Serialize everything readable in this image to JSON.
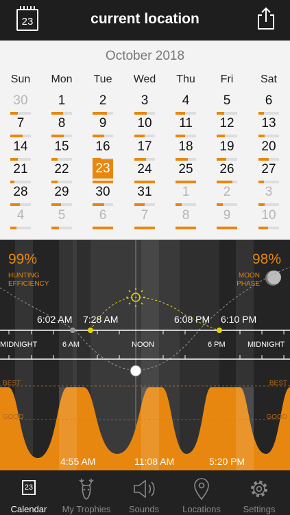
{
  "header": {
    "title": "current location",
    "calendar_icon_day": "23"
  },
  "calendar": {
    "month": "October 2018",
    "weekdays": [
      "Sun",
      "Mon",
      "Tue",
      "Wed",
      "Thu",
      "Fri",
      "Sat"
    ],
    "weeks": [
      [
        {
          "d": "30",
          "f": 0.35,
          "dim": true
        },
        {
          "d": "1",
          "f": 0.55
        },
        {
          "d": "2",
          "f": 0.7
        },
        {
          "d": "3",
          "f": 0.6
        },
        {
          "d": "4",
          "f": 0.45
        },
        {
          "d": "5",
          "f": 0.35
        },
        {
          "d": "6",
          "f": 0.25
        }
      ],
      [
        {
          "d": "7",
          "f": 0.6
        },
        {
          "d": "8",
          "f": 0.6
        },
        {
          "d": "9",
          "f": 0.55
        },
        {
          "d": "10",
          "f": 0.5
        },
        {
          "d": "11",
          "f": 0.45
        },
        {
          "d": "12",
          "f": 0.4
        },
        {
          "d": "13",
          "f": 0.3
        }
      ],
      [
        {
          "d": "14",
          "f": 0.35
        },
        {
          "d": "15",
          "f": 0.3
        },
        {
          "d": "16",
          "f": 0.4
        },
        {
          "d": "17",
          "f": 0.55
        },
        {
          "d": "18",
          "f": 0.6
        },
        {
          "d": "19",
          "f": 0.45
        },
        {
          "d": "20",
          "f": 0.5
        }
      ],
      [
        {
          "d": "21",
          "f": 0.2
        },
        {
          "d": "22",
          "f": 0.3
        },
        {
          "d": "23",
          "f": 0.99,
          "sel": true
        },
        {
          "d": "24",
          "f": 1.0
        },
        {
          "d": "25",
          "f": 1.0
        },
        {
          "d": "26",
          "f": 0.75
        },
        {
          "d": "27",
          "f": 0.25
        }
      ],
      [
        {
          "d": "28",
          "f": 0.45
        },
        {
          "d": "29",
          "f": 0.45
        },
        {
          "d": "30",
          "f": 0.55
        },
        {
          "d": "31",
          "f": 0.5
        },
        {
          "d": "1",
          "f": 0.3,
          "dim": true
        },
        {
          "d": "2",
          "f": 0.3,
          "dim": true
        },
        {
          "d": "3",
          "f": 0.3,
          "dim": true
        }
      ],
      [
        {
          "d": "4",
          "f": 0.3,
          "dim": true
        },
        {
          "d": "5",
          "f": 0.35,
          "dim": true
        },
        {
          "d": "6",
          "f": 1.0,
          "dim": true
        },
        {
          "d": "7",
          "f": 1.0,
          "dim": true
        },
        {
          "d": "8",
          "f": 1.0,
          "dim": true
        },
        {
          "d": "9",
          "f": 1.0,
          "dim": true
        },
        {
          "d": "10",
          "f": 0.45,
          "dim": true
        }
      ]
    ]
  },
  "stats": {
    "hunting_efficiency": "99%",
    "hunting_efficiency_label_1": "HUNTING",
    "hunting_efficiency_label_2": "EFFICIENCY",
    "moon_phase": "98%",
    "moon_phase_label_1": "MOON",
    "moon_phase_label_2": "PHASE"
  },
  "sun": {
    "rise_1": "6:02 AM",
    "rise_2": "7:28 AM",
    "set_1": "6:08 PM",
    "set_2": "6:10 PM"
  },
  "timeline": {
    "midnight_left": "MIDNIGHT",
    "six_am": "6 AM",
    "noon": "NOON",
    "six_pm": "6 PM",
    "midnight_right": "MIDNIGHT"
  },
  "activity": {
    "best_left": "BEST",
    "best_right": "BEST",
    "good_left": "GOOD",
    "good_right": "GOOD",
    "peak_1": "4:55 AM",
    "peak_2": "11:08 AM",
    "peak_3": "5:20 PM"
  },
  "colors": {
    "accent": "#e8870f",
    "sun_yellow": "#e3d400"
  },
  "tabs": [
    {
      "label": "Calendar",
      "icon": "calendar-icon",
      "active": true,
      "day": "23"
    },
    {
      "label": "My Trophies",
      "icon": "deer-icon"
    },
    {
      "label": "Sounds",
      "icon": "speaker-icon"
    },
    {
      "label": "Locations",
      "icon": "location-pin-icon"
    },
    {
      "label": "Settings",
      "icon": "gear-icon"
    }
  ]
}
